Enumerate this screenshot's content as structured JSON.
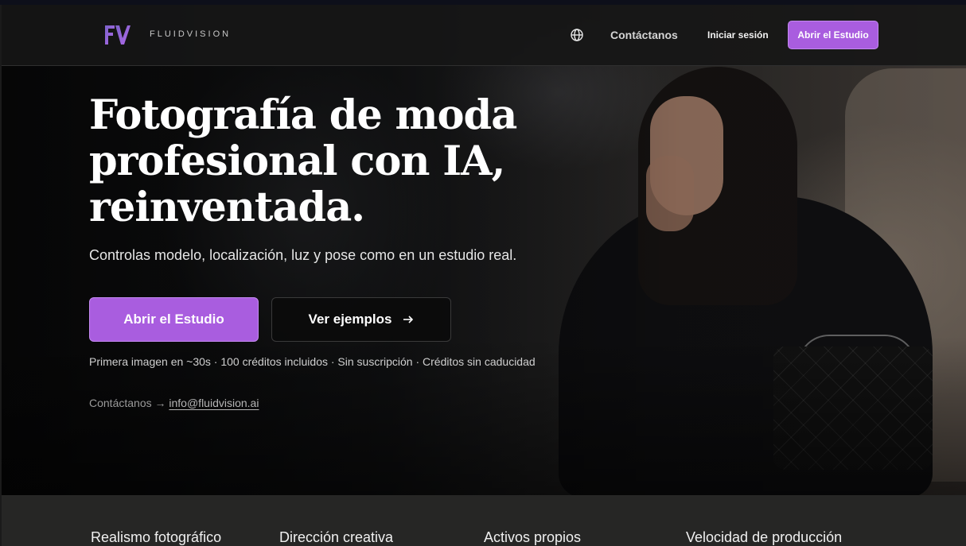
{
  "nav": {
    "brand": "FLUIDVISION",
    "logo_icon": "fv-logo-icon",
    "language_icon": "globe-icon",
    "contact": "Contáctanos",
    "login": "Iniciar sesión",
    "cta": "Abrir el Estudio"
  },
  "hero": {
    "headline_lines": [
      "Fotografía de moda",
      "profesional con IA,",
      "reinventada."
    ],
    "subtitle": "Controlas modelo, localización, luz y pose como en un estudio real.",
    "primary_button": "Abrir el Estudio",
    "secondary_button": "Ver ejemplos",
    "secondary_icon": "arrow-right-icon",
    "meta": "Primera imagen en ~30s · 100 créditos incluidos · Sin suscripción · Créditos sin caducidad",
    "contact_prefix": "Contáctanos →",
    "contact_email": "info@fluidvision.ai"
  },
  "features": [
    "Realismo fotográfico",
    "Dirección creativa",
    "Activos propios",
    "Velocidad de producción"
  ],
  "colors": {
    "accent": "#a95ddf",
    "accent_border": "#c389f0",
    "background": "#151515",
    "features_bg": "#262625"
  }
}
